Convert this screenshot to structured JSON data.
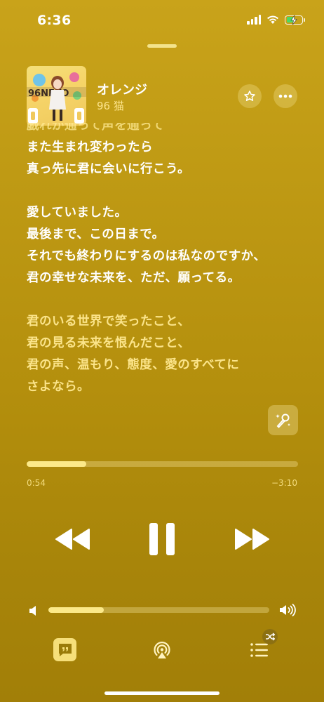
{
  "status_bar": {
    "time": "6:36",
    "battery_level": 0.45,
    "charging": true
  },
  "now_playing": {
    "title": "オレンジ",
    "artist": "96 猫",
    "artwork_text": "96NEKO"
  },
  "lyrics": [
    {
      "text": "戯れが通って声を通って",
      "state": "faded"
    },
    {
      "text": "また生まれ変わったら",
      "state": "active"
    },
    {
      "text": "真っ先に君に会いに行こう。",
      "state": "active"
    },
    {
      "text": "",
      "state": "gap"
    },
    {
      "text": "愛していました。",
      "state": "active"
    },
    {
      "text": "最後まで、この日まで。",
      "state": "active"
    },
    {
      "text": "それでも終わりにするのは私なのですか、",
      "state": "active"
    },
    {
      "text": "君の幸せな未来を、ただ、願ってる。",
      "state": "active"
    },
    {
      "text": "",
      "state": "gap"
    },
    {
      "text": "君のいる世界で笑ったこと、",
      "state": "upcoming"
    },
    {
      "text": "君の見る未来を恨んだこと、",
      "state": "upcoming"
    },
    {
      "text": "君の声、温もり、態度、愛のすべてに",
      "state": "upcoming"
    },
    {
      "text": "さよなら。",
      "state": "upcoming"
    }
  ],
  "playback": {
    "elapsed": "0:54",
    "remaining": "−3:10",
    "progress": 0.22
  },
  "volume": {
    "level": 0.25
  },
  "icons": {
    "star": "star-icon",
    "more": "ellipsis-icon",
    "karaoke": "microphone-sparkle-icon",
    "rewind": "rewind-icon",
    "pause": "pause-icon",
    "forward": "fast-forward-icon",
    "airplay": "airplay-icon",
    "queue": "list-icon",
    "shuffle": "shuffle-icon",
    "lyrics": "quote-bubble-icon"
  },
  "colors": {
    "background": "#bf9a14",
    "accent": "#fce989",
    "lyric_upcoming": "#fbe48a",
    "battery": "#4cd964"
  }
}
